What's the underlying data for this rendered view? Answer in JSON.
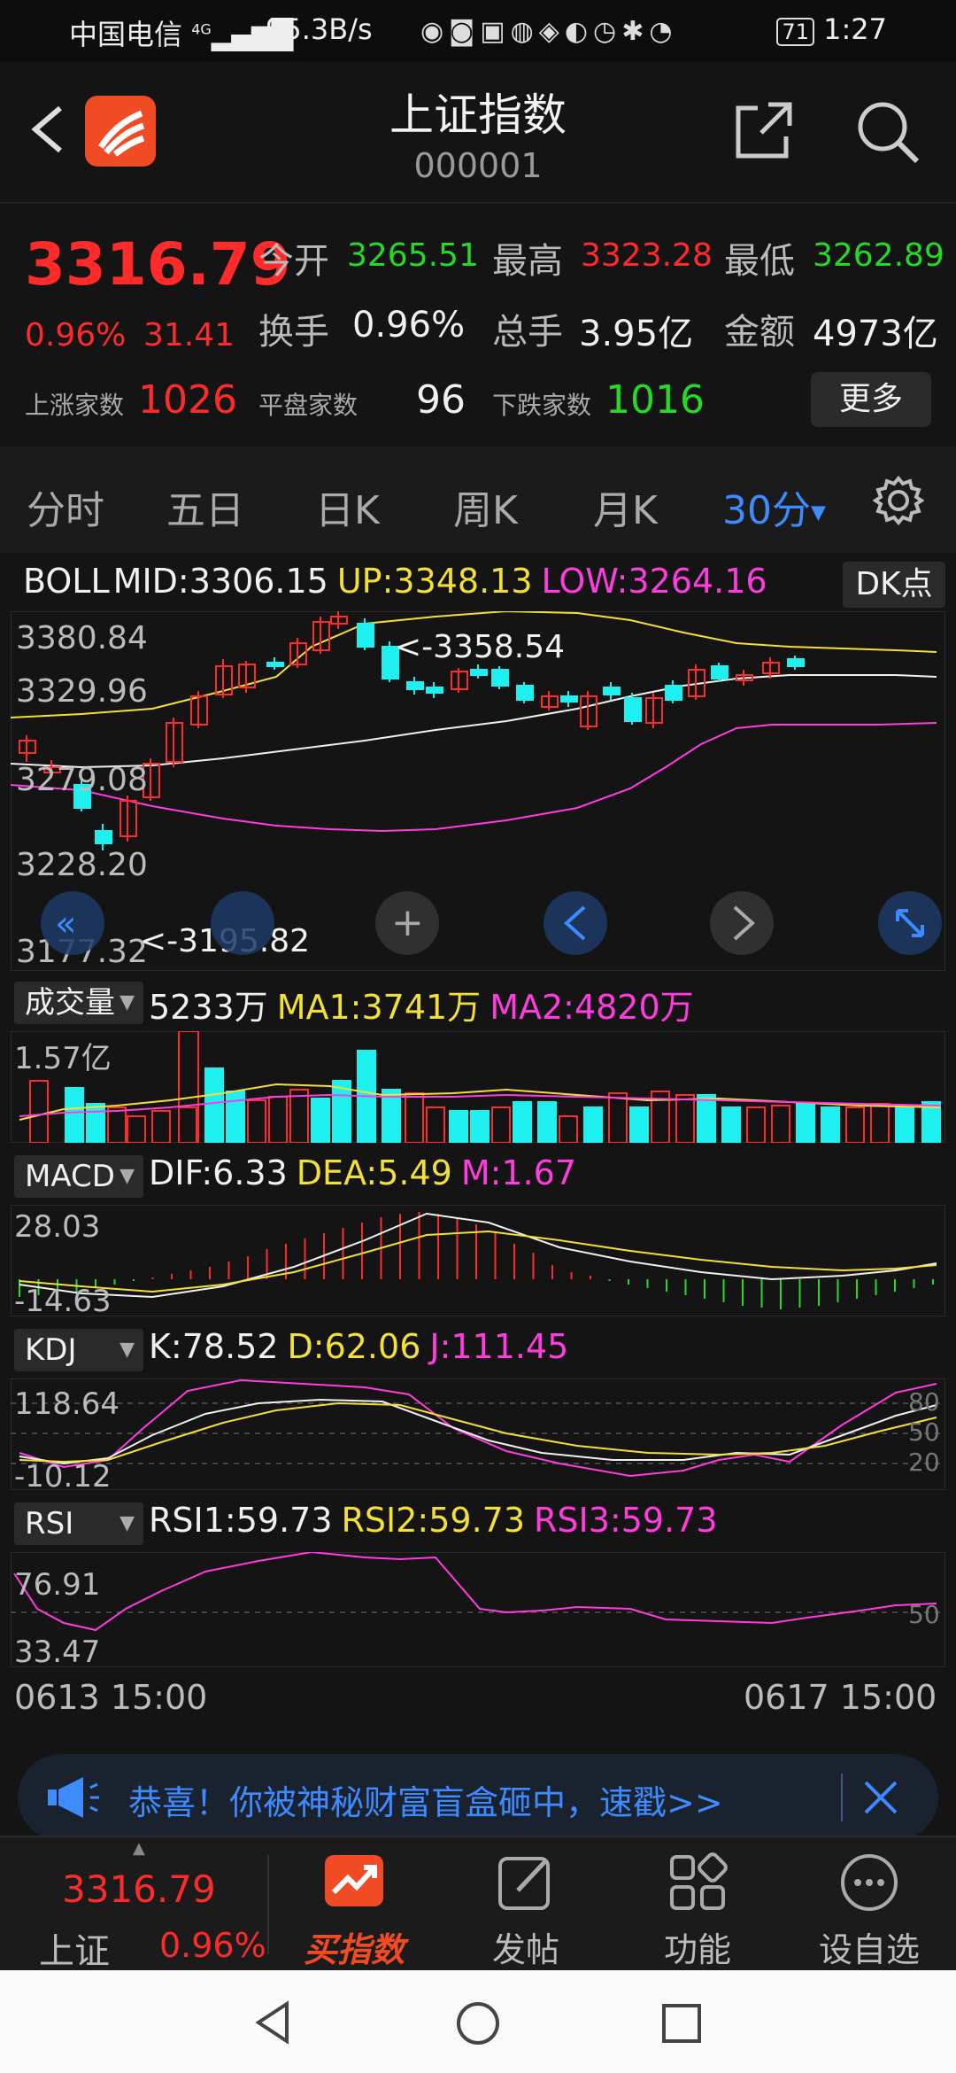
{
  "status_bar": {
    "carrier": "中国电信",
    "network": "4G",
    "speed": "95.3B/s",
    "battery": "71",
    "time": "1:27"
  },
  "header": {
    "title": "上证指数",
    "code": "000001"
  },
  "quote": {
    "price": "3316.79",
    "pct": "0.96%",
    "change": "31.41",
    "open_label": "今开",
    "open": "3265.51",
    "high_label": "最高",
    "high": "3323.28",
    "low_label": "最低",
    "low": "3262.89",
    "turnover_label": "换手",
    "turnover": "0.96%",
    "volume_label": "总手",
    "volume": "3.95亿",
    "amount_label": "金额",
    "amount": "4973亿",
    "up_label": "上涨家数",
    "up": "1026",
    "flat_label": "平盘家数",
    "flat": "96",
    "down_label": "下跌家数",
    "down": "1016",
    "more_label": "更多"
  },
  "tabs": [
    {
      "label": "分时"
    },
    {
      "label": "五日"
    },
    {
      "label": "日K"
    },
    {
      "label": "周K"
    },
    {
      "label": "月K"
    },
    {
      "label": "30分"
    }
  ],
  "boll": {
    "name": "BOLL",
    "mid": "MID:3306.15",
    "up": "UP:3348.13",
    "low": "LOW:3264.16",
    "dk_label": "DK点",
    "y_ticks": [
      "3380.84",
      "3329.96",
      "3279.08",
      "3228.20",
      "3177.32"
    ],
    "max_note": "<-3358.54",
    "min_note": "<-3195.82"
  },
  "volume": {
    "name": "成交量",
    "value": "5233万",
    "ma1": "MA1:3741万",
    "ma2": "MA2:4820万",
    "y_tick": "1.57亿"
  },
  "macd": {
    "name": "MACD",
    "dif": "DIF:6.33",
    "dea": "DEA:5.49",
    "m": "M:1.67",
    "y_ticks": [
      "28.03",
      "-14.63"
    ]
  },
  "kdj": {
    "name": "KDJ",
    "k": "K:78.52",
    "d": "D:62.06",
    "j": "J:111.45",
    "y_ticks": [
      "118.64",
      "-10.12"
    ],
    "levels": [
      "80",
      "50",
      "20"
    ]
  },
  "rsi": {
    "name": "RSI",
    "rsi1": "RSI1:59.73",
    "rsi2": "RSI2:59.73",
    "rsi3": "RSI3:59.73",
    "y_ticks": [
      "76.91",
      "33.47"
    ],
    "level": "50"
  },
  "time_axis": {
    "start": "0613 15:00",
    "end": "0617 15:00"
  },
  "banner": {
    "text": "恭喜！你被神秘财富盲盒砸中，速戳>>"
  },
  "bottom_nav": {
    "index_price": "3316.79",
    "index_name": "上证",
    "index_pct": "0.96%",
    "items": [
      {
        "label": "买指数"
      },
      {
        "label": "发帖"
      },
      {
        "label": "功能"
      },
      {
        "label": "设自选"
      }
    ]
  },
  "colors": {
    "up": "#ff2b2b",
    "down": "#1ef0f0",
    "accent": "#3d8bff",
    "yellow": "#f3e037",
    "magenta": "#ff3cde"
  }
}
